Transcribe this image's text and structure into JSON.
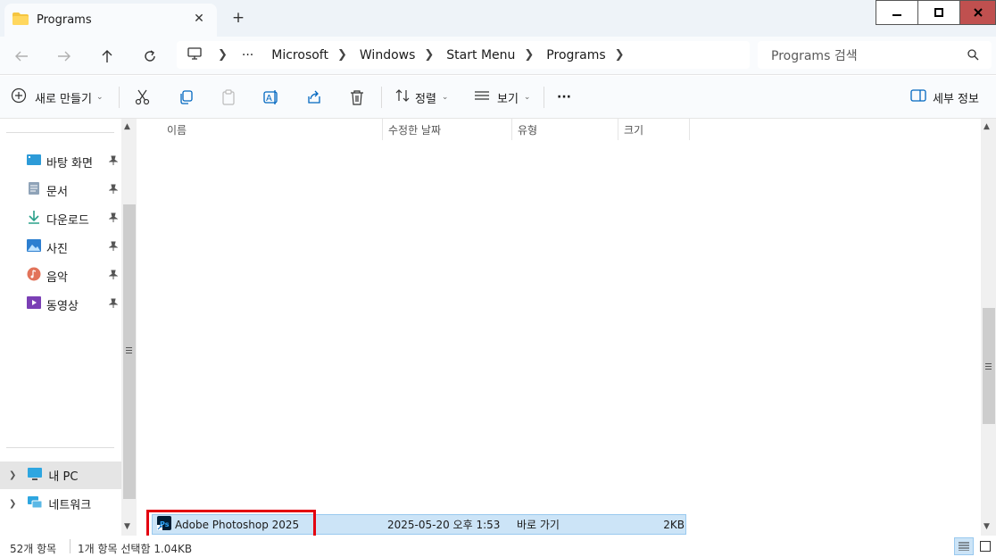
{
  "tab": {
    "title": "Programs",
    "close": "✕",
    "new": "+"
  },
  "window": {
    "min": "—",
    "max": "☐",
    "close": "✕"
  },
  "address": {
    "ellipsis": "···",
    "crumbs": [
      "Microsoft",
      "Windows",
      "Start Menu",
      "Programs"
    ]
  },
  "search": {
    "placeholder": "Programs 검색"
  },
  "toolbar": {
    "new_label": "새로 만들기",
    "sort_label": "정렬",
    "view_label": "보기",
    "more": "···",
    "details_label": "세부 정보"
  },
  "sidebar": {
    "quick": [
      {
        "label": "바탕 화면",
        "icon": "desktop-icon"
      },
      {
        "label": "문서",
        "icon": "document-icon"
      },
      {
        "label": "다운로드",
        "icon": "download-icon"
      },
      {
        "label": "사진",
        "icon": "pictures-icon"
      },
      {
        "label": "음악",
        "icon": "music-icon"
      },
      {
        "label": "동영상",
        "icon": "video-icon"
      }
    ],
    "tree": [
      {
        "label": "내 PC",
        "icon": "pc-icon"
      },
      {
        "label": "네트워크",
        "icon": "network-icon"
      }
    ]
  },
  "columns": {
    "name": "이름",
    "modified": "수정한 날짜",
    "type": "유형",
    "size": "크기"
  },
  "files": [
    {
      "name": "Adobe Photoshop 2025",
      "modified": "2025-05-20 오후 1:53",
      "type": "바로 가기",
      "size": "2KB"
    }
  ],
  "status": {
    "count": "52개 항목",
    "selection": "1개 항목 선택함 1.04KB"
  },
  "colors": {
    "accent": "#0067c0",
    "selection": "#cce4f7",
    "highlight": "#e3000f",
    "close_button": "#c0504f"
  }
}
